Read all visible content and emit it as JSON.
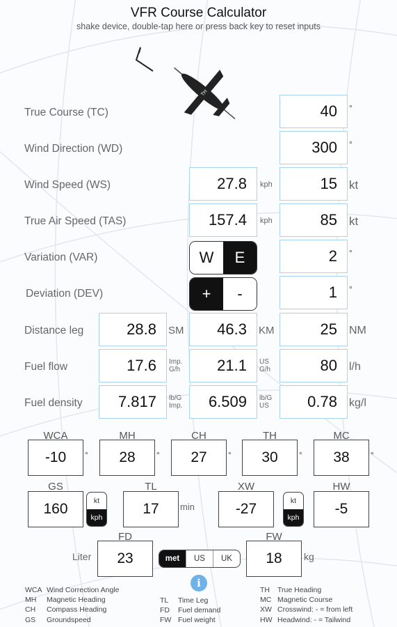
{
  "header": {
    "title": "VFR Course Calculator",
    "subtitle": "shake device, double-tap here or press back key to reset inputs"
  },
  "inputs": {
    "true_course": {
      "label": "True Course (TC)",
      "value": "40",
      "unit": "°"
    },
    "wind_direction": {
      "label": "Wind Direction (WD)",
      "value": "300",
      "unit": "°"
    },
    "wind_speed": {
      "label": "Wind Speed (WS)",
      "value_kph": "27.8",
      "unit_kph": "kph",
      "value_kt": "15",
      "unit_kt": "kt"
    },
    "true_air_speed": {
      "label": "True Air Speed (TAS)",
      "value_kph": "157.4",
      "unit_kph": "kph",
      "value_kt": "85",
      "unit_kt": "kt"
    },
    "variation": {
      "label": "Variation (VAR)",
      "opt_w": "W",
      "opt_e": "E",
      "selected": "E",
      "value": "2",
      "unit": "°"
    },
    "deviation": {
      "label": "Deviation (DEV)",
      "opt_plus": "+",
      "opt_minus": "-",
      "selected": "+",
      "value": "1",
      "unit": "°"
    },
    "distance": {
      "label": "Distance leg",
      "sm": "28.8",
      "sm_unit": "SM",
      "km": "46.3",
      "km_unit": "KM",
      "nm": "25",
      "nm_unit": "NM"
    },
    "fuel_flow": {
      "label": "Fuel flow",
      "imp": "17.6",
      "imp_unit_1": "Imp.",
      "imp_unit_2": "G/h",
      "us": "21.1",
      "us_unit_1": "US",
      "us_unit_2": "G/h",
      "lh": "80",
      "lh_unit": "l/h"
    },
    "fuel_density": {
      "label": "Fuel density",
      "imp": "7.817",
      "imp_unit_1": "lb/G",
      "imp_unit_2": "Imp.",
      "us": "6.509",
      "us_unit_1": "lb/G",
      "us_unit_2": "US",
      "kgl": "0.78",
      "kgl_unit": "kg/l"
    }
  },
  "results": {
    "wca": {
      "label": "WCA",
      "value": "-10"
    },
    "mh": {
      "label": "MH",
      "value": "28"
    },
    "ch": {
      "label": "CH",
      "value": "27"
    },
    "th": {
      "label": "TH",
      "value": "30"
    },
    "mc": {
      "label": "MC",
      "value": "38"
    },
    "deg": "°",
    "gs": {
      "label": "GS",
      "value": "160",
      "kt": "kt",
      "kph": "kph",
      "selected": "kph"
    },
    "tl": {
      "label": "TL",
      "value": "17",
      "unit": "min"
    },
    "xw": {
      "label": "XW",
      "value": "-27",
      "kt": "kt",
      "kph": "kph",
      "selected": "kph"
    },
    "hw": {
      "label": "HW",
      "value": "-5"
    },
    "fd": {
      "label": "FD",
      "value": "23",
      "prefix": "Liter"
    },
    "fw": {
      "label": "FW",
      "value": "18",
      "unit": "kg"
    },
    "unit_system": {
      "options": [
        "met",
        "US",
        "UK"
      ],
      "selected": "met"
    }
  },
  "legend": {
    "col1": [
      {
        "abbr": "WCA",
        "text": "Wind Correction Angle"
      },
      {
        "abbr": "MH",
        "text": "Magnetic Heading"
      },
      {
        "abbr": "CH",
        "text": "Compass Heading"
      },
      {
        "abbr": "GS",
        "text": "Groundspeed"
      }
    ],
    "col2": [
      {
        "abbr": "TL",
        "text": "Time Leg"
      },
      {
        "abbr": "FD",
        "text": "Fuel demand"
      },
      {
        "abbr": "FW",
        "text": "Fuel weight"
      }
    ],
    "col3": [
      {
        "abbr": "TH",
        "text": "True Heading"
      },
      {
        "abbr": "MC",
        "text": "Magnetic Course"
      },
      {
        "abbr": "XW",
        "text": "Crosswind:  - = from left"
      },
      {
        "abbr": "HW",
        "text": "Headwind:  - = Tailwind"
      }
    ]
  },
  "icons": {
    "info": "info-icon",
    "airplane": "airplane-icon",
    "wind": "wind-arrow-icon"
  },
  "colors": {
    "field_border": "#a9d4ef",
    "accent": "#6fb2e8",
    "selected": "#111111"
  }
}
